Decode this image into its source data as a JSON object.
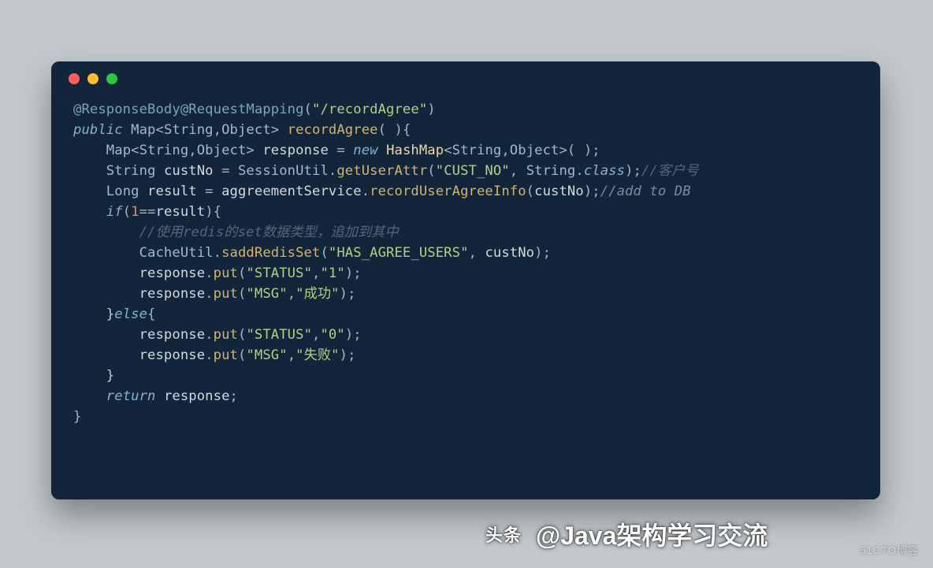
{
  "titlebar": {
    "dots": [
      "red",
      "yellow",
      "green"
    ]
  },
  "code": {
    "t": {
      "anno_rb": "@ResponseBody",
      "anno_rm": "@RequestMapping",
      "path": "\"/recordAgree\"",
      "kw_public": "public",
      "map": "Map",
      "string": "String",
      "object": "Object",
      "fn_record": "recordAgree",
      "response": "response",
      "kw_new": "new",
      "hashmap": "HashMap",
      "custNo": "custNo",
      "sessionutil": "SessionUtil",
      "getuserattr": "getUserAttr",
      "cust_no": "\"CUST_NO\"",
      "kw_class": "class",
      "c_khh": "//客户号",
      "long": "Long",
      "result": "result",
      "aggservice": "aggreementService",
      "recorduser": "recordUserAgreeInfo",
      "c_addtodb": "//add to DB",
      "kw_if": "if",
      "one": "1",
      "c_redis1": "//使用redis的set数据类型，追加到其中",
      "cacheutil": "CacheUtil",
      "saddredis": "saddRedisSet",
      "hasagree": "\"HAS_AGREE_USERS\"",
      "put": "put",
      "status": "\"STATUS\"",
      "one_s": "\"1\"",
      "msg": "\"MSG\"",
      "success": "\"成功\"",
      "kw_else": "else",
      "zero_s": "\"0\"",
      "fail": "\"失败\"",
      "kw_return": "return"
    }
  },
  "watermark": {
    "label": "头条",
    "attr": "@Java架构学习交流",
    "right": "51CTO博客"
  }
}
